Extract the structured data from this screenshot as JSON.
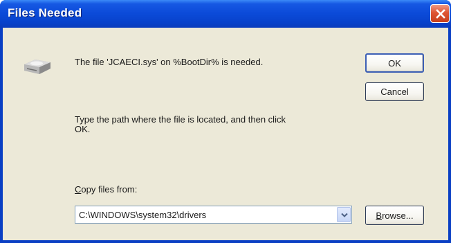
{
  "window": {
    "title": "Files Needed"
  },
  "message": {
    "file_needed": "The file 'JCAECI.sys' on %BootDir% is needed.",
    "instruction_line1": "Type the path where the file is located, and then click",
    "instruction_line2": "OK."
  },
  "buttons": {
    "ok": "OK",
    "cancel": "Cancel",
    "browse_prefix": "B",
    "browse_rest": "rowse..."
  },
  "copy_from": {
    "label_prefix": "C",
    "label_rest": "opy files from:",
    "value": "C:\\WINDOWS\\system32\\drivers"
  },
  "icons": {
    "close": "close-x-icon",
    "disk": "disk-drive-icon",
    "dropdown": "chevron-down-icon"
  },
  "colors": {
    "title_bar": "#0b4ad8",
    "client_bg": "#ece9d8",
    "close_button": "#de5533"
  }
}
